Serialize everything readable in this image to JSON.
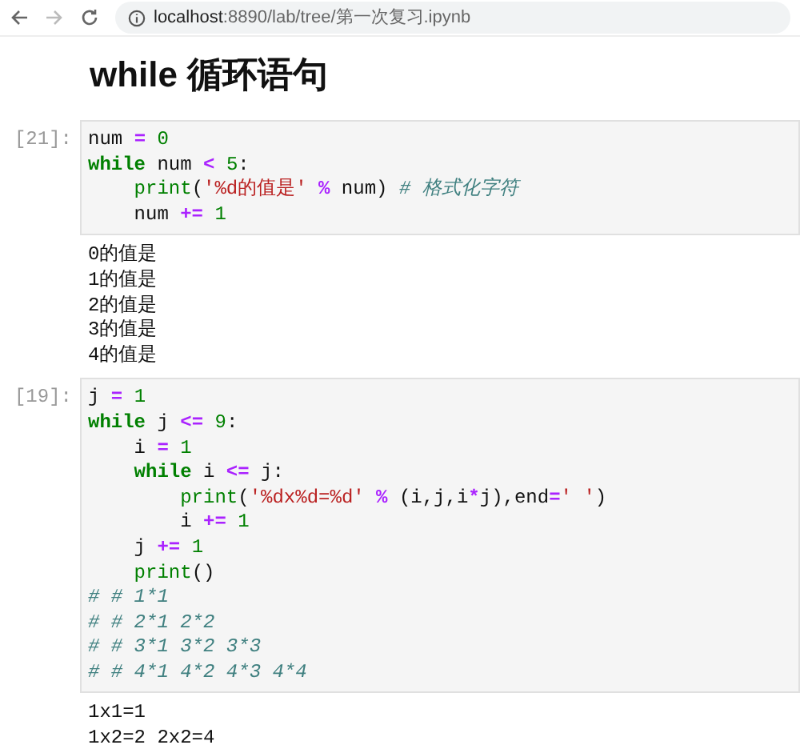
{
  "browser": {
    "url_host": "localhost",
    "url_rest": ":8890/lab/tree/第一次复习.ipynb"
  },
  "heading": "while 循环语句",
  "cells": [
    {
      "prompt": "[21]:",
      "code": [
        [
          {
            "t": "num ",
            "kind": "name"
          },
          {
            "t": "= ",
            "kind": "op"
          },
          {
            "t": "0",
            "kind": "num"
          }
        ],
        [
          {
            "t": "while",
            "kind": "kw"
          },
          {
            "t": " num ",
            "kind": "name"
          },
          {
            "t": "< ",
            "kind": "op"
          },
          {
            "t": "5",
            "kind": "num"
          },
          {
            "t": ":",
            "kind": "name"
          }
        ],
        [
          {
            "t": "    print",
            "kind": "builtin"
          },
          {
            "t": "(",
            "kind": "name"
          },
          {
            "t": "'%d的值是' ",
            "kind": "str"
          },
          {
            "t": "%",
            "kind": "op"
          },
          {
            "t": " num) ",
            "kind": "name"
          },
          {
            "t": "# 格式化字符",
            "kind": "comment"
          }
        ],
        [
          {
            "t": "    num ",
            "kind": "name"
          },
          {
            "t": "+= ",
            "kind": "op"
          },
          {
            "t": "1",
            "kind": "num"
          }
        ]
      ],
      "output": [
        "0的值是",
        "1的值是",
        "2的值是",
        "3的值是",
        "4的值是"
      ]
    },
    {
      "prompt": "[19]:",
      "code": [
        [
          {
            "t": "j ",
            "kind": "name"
          },
          {
            "t": "= ",
            "kind": "op"
          },
          {
            "t": "1",
            "kind": "num"
          }
        ],
        [
          {
            "t": "while",
            "kind": "kw"
          },
          {
            "t": " j ",
            "kind": "name"
          },
          {
            "t": "<= ",
            "kind": "op"
          },
          {
            "t": "9",
            "kind": "num"
          },
          {
            "t": ":",
            "kind": "name"
          }
        ],
        [
          {
            "t": "    i ",
            "kind": "name"
          },
          {
            "t": "= ",
            "kind": "op"
          },
          {
            "t": "1",
            "kind": "num"
          }
        ],
        [
          {
            "t": "    while",
            "kind": "kw"
          },
          {
            "t": " i ",
            "kind": "name"
          },
          {
            "t": "<=",
            "kind": "op"
          },
          {
            "t": " j:",
            "kind": "name"
          }
        ],
        [
          {
            "t": "        print",
            "kind": "builtin"
          },
          {
            "t": "(",
            "kind": "name"
          },
          {
            "t": "'%dx%d=%d' ",
            "kind": "str"
          },
          {
            "t": "%",
            "kind": "op"
          },
          {
            "t": " (i,j,i",
            "kind": "name"
          },
          {
            "t": "*",
            "kind": "op"
          },
          {
            "t": "j),end",
            "kind": "name"
          },
          {
            "t": "=",
            "kind": "op"
          },
          {
            "t": "' '",
            "kind": "str"
          },
          {
            "t": ")",
            "kind": "name"
          }
        ],
        [
          {
            "t": "        i ",
            "kind": "name"
          },
          {
            "t": "+= ",
            "kind": "op"
          },
          {
            "t": "1",
            "kind": "num"
          }
        ],
        [
          {
            "t": "    j ",
            "kind": "name"
          },
          {
            "t": "+= ",
            "kind": "op"
          },
          {
            "t": "1",
            "kind": "num"
          }
        ],
        [
          {
            "t": "    print",
            "kind": "builtin"
          },
          {
            "t": "()",
            "kind": "name"
          }
        ],
        [
          {
            "t": "# # 1*1",
            "kind": "comment"
          }
        ],
        [
          {
            "t": "# # 2*1 2*2",
            "kind": "comment"
          }
        ],
        [
          {
            "t": "# # 3*1 3*2 3*3",
            "kind": "comment"
          }
        ],
        [
          {
            "t": "# # 4*1 4*2 4*3 4*4",
            "kind": "comment"
          }
        ]
      ],
      "output": [
        "1x1=1",
        "1x2=2 2x2=4"
      ]
    }
  ]
}
